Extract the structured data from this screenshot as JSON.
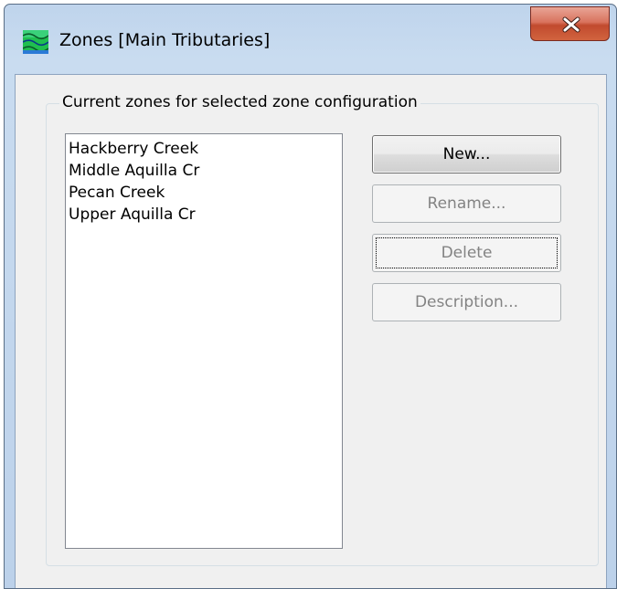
{
  "window": {
    "title": "Zones [Main Tributaries]",
    "app_icon": "zones-map-icon",
    "close_icon": "close-icon",
    "close_color": "#c75050"
  },
  "group": {
    "legend": "Current zones for selected zone configuration"
  },
  "zones_list": {
    "items": [
      "Hackberry Creek",
      "Middle Aquilla Cr",
      "Pecan Creek",
      "Upper Aquilla Cr"
    ]
  },
  "buttons": {
    "new_label": "New...",
    "rename_label": "Rename...",
    "delete_label": "Delete",
    "description_label": "Description...",
    "rename_enabled": false,
    "delete_enabled": false,
    "description_enabled": false
  }
}
